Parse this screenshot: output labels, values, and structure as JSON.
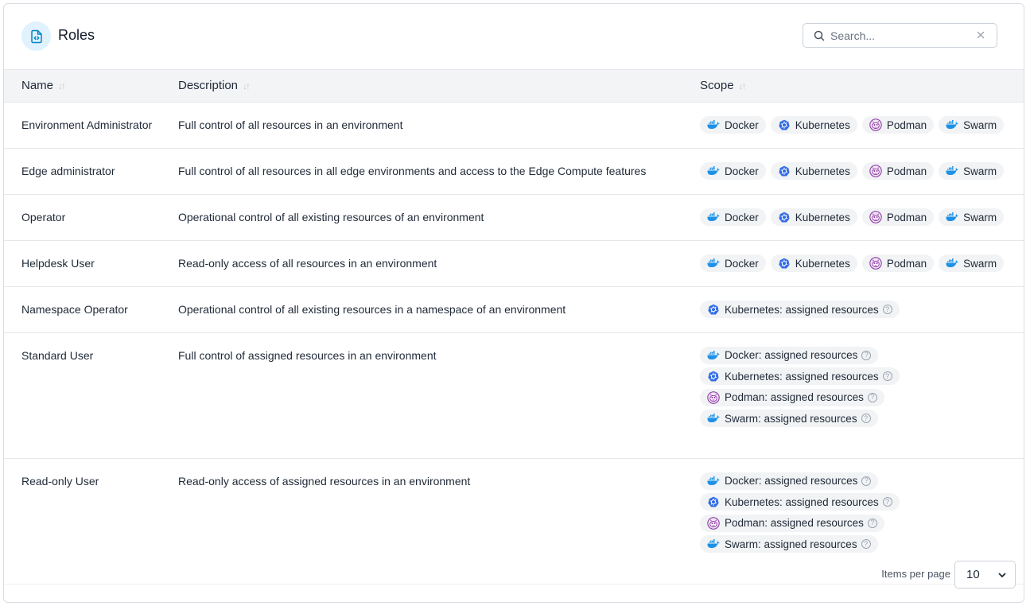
{
  "header": {
    "title": "Roles",
    "search_placeholder": "Search..."
  },
  "table": {
    "columns": [
      "Name",
      "Description",
      "Scope"
    ],
    "rows": [
      {
        "name": "Environment Administrator",
        "description": "Full control of all resources in an environment",
        "scope": [
          "Docker",
          "Kubernetes",
          "Podman",
          "Swarm"
        ]
      },
      {
        "name": "Edge administrator",
        "description": "Full control of all resources in all edge environments and access to the Edge Compute features",
        "scope": [
          "Docker",
          "Kubernetes",
          "Podman",
          "Swarm"
        ]
      },
      {
        "name": "Operator",
        "description": "Operational control of all existing resources of an environment",
        "scope": [
          "Docker",
          "Kubernetes",
          "Podman",
          "Swarm"
        ]
      },
      {
        "name": "Helpdesk User",
        "description": "Read-only access of all resources in an environment",
        "scope": [
          "Docker",
          "Kubernetes",
          "Podman",
          "Swarm"
        ]
      },
      {
        "name": "Namespace Operator",
        "description": "Operational control of all existing resources in a namespace of an environment",
        "scope": [
          "Kubernetes: assigned resources"
        ]
      },
      {
        "name": "Standard User",
        "description": "Full control of assigned resources in an environment",
        "scope": [
          "Docker: assigned resources",
          "Kubernetes: assigned resources",
          "Podman: assigned resources",
          "Swarm: assigned resources"
        ]
      },
      {
        "name": "Read-only User",
        "description": "Read-only access of assigned resources in an environment",
        "scope": [
          "Docker: assigned resources",
          "Kubernetes: assigned resources",
          "Podman: assigned resources",
          "Swarm: assigned resources"
        ]
      }
    ]
  },
  "footer": {
    "items_per_page_label": "Items per page",
    "items_per_page_value": "10"
  },
  "colors": {
    "docker": "#1d91e6",
    "kubernetes": "#326ce5",
    "podman": "#892ca0",
    "icon_bg": "#e0f2fe",
    "icon_fg": "#0284c7"
  }
}
